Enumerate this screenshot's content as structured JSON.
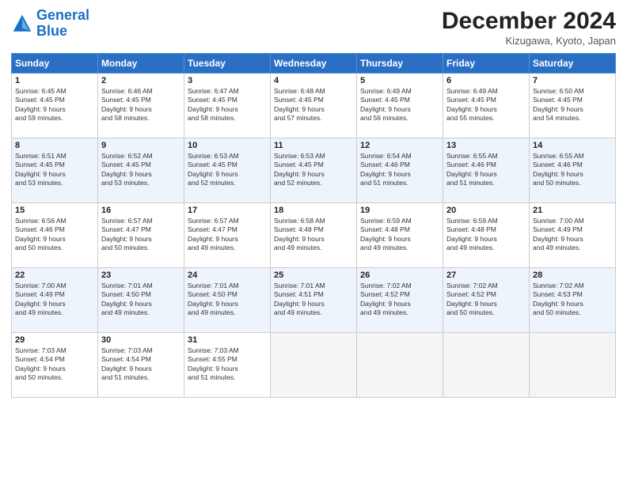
{
  "header": {
    "logo_general": "General",
    "logo_blue": "Blue",
    "title": "December 2024",
    "location": "Kizugawa, Kyoto, Japan"
  },
  "columns": [
    "Sunday",
    "Monday",
    "Tuesday",
    "Wednesday",
    "Thursday",
    "Friday",
    "Saturday"
  ],
  "weeks": [
    [
      {
        "day": "1",
        "info": "Sunrise: 6:45 AM\nSunset: 4:45 PM\nDaylight: 9 hours\nand 59 minutes."
      },
      {
        "day": "2",
        "info": "Sunrise: 6:46 AM\nSunset: 4:45 PM\nDaylight: 9 hours\nand 58 minutes."
      },
      {
        "day": "3",
        "info": "Sunrise: 6:47 AM\nSunset: 4:45 PM\nDaylight: 9 hours\nand 58 minutes."
      },
      {
        "day": "4",
        "info": "Sunrise: 6:48 AM\nSunset: 4:45 PM\nDaylight: 9 hours\nand 57 minutes."
      },
      {
        "day": "5",
        "info": "Sunrise: 6:49 AM\nSunset: 4:45 PM\nDaylight: 9 hours\nand 56 minutes."
      },
      {
        "day": "6",
        "info": "Sunrise: 6:49 AM\nSunset: 4:45 PM\nDaylight: 9 hours\nand 55 minutes."
      },
      {
        "day": "7",
        "info": "Sunrise: 6:50 AM\nSunset: 4:45 PM\nDaylight: 9 hours\nand 54 minutes."
      }
    ],
    [
      {
        "day": "8",
        "info": "Sunrise: 6:51 AM\nSunset: 4:45 PM\nDaylight: 9 hours\nand 53 minutes."
      },
      {
        "day": "9",
        "info": "Sunrise: 6:52 AM\nSunset: 4:45 PM\nDaylight: 9 hours\nand 53 minutes."
      },
      {
        "day": "10",
        "info": "Sunrise: 6:53 AM\nSunset: 4:45 PM\nDaylight: 9 hours\nand 52 minutes."
      },
      {
        "day": "11",
        "info": "Sunrise: 6:53 AM\nSunset: 4:45 PM\nDaylight: 9 hours\nand 52 minutes."
      },
      {
        "day": "12",
        "info": "Sunrise: 6:54 AM\nSunset: 4:46 PM\nDaylight: 9 hours\nand 51 minutes."
      },
      {
        "day": "13",
        "info": "Sunrise: 6:55 AM\nSunset: 4:46 PM\nDaylight: 9 hours\nand 51 minutes."
      },
      {
        "day": "14",
        "info": "Sunrise: 6:55 AM\nSunset: 4:46 PM\nDaylight: 9 hours\nand 50 minutes."
      }
    ],
    [
      {
        "day": "15",
        "info": "Sunrise: 6:56 AM\nSunset: 4:46 PM\nDaylight: 9 hours\nand 50 minutes."
      },
      {
        "day": "16",
        "info": "Sunrise: 6:57 AM\nSunset: 4:47 PM\nDaylight: 9 hours\nand 50 minutes."
      },
      {
        "day": "17",
        "info": "Sunrise: 6:57 AM\nSunset: 4:47 PM\nDaylight: 9 hours\nand 49 minutes."
      },
      {
        "day": "18",
        "info": "Sunrise: 6:58 AM\nSunset: 4:48 PM\nDaylight: 9 hours\nand 49 minutes."
      },
      {
        "day": "19",
        "info": "Sunrise: 6:59 AM\nSunset: 4:48 PM\nDaylight: 9 hours\nand 49 minutes."
      },
      {
        "day": "20",
        "info": "Sunrise: 6:59 AM\nSunset: 4:48 PM\nDaylight: 9 hours\nand 49 minutes."
      },
      {
        "day": "21",
        "info": "Sunrise: 7:00 AM\nSunset: 4:49 PM\nDaylight: 9 hours\nand 49 minutes."
      }
    ],
    [
      {
        "day": "22",
        "info": "Sunrise: 7:00 AM\nSunset: 4:49 PM\nDaylight: 9 hours\nand 49 minutes."
      },
      {
        "day": "23",
        "info": "Sunrise: 7:01 AM\nSunset: 4:50 PM\nDaylight: 9 hours\nand 49 minutes."
      },
      {
        "day": "24",
        "info": "Sunrise: 7:01 AM\nSunset: 4:50 PM\nDaylight: 9 hours\nand 49 minutes."
      },
      {
        "day": "25",
        "info": "Sunrise: 7:01 AM\nSunset: 4:51 PM\nDaylight: 9 hours\nand 49 minutes."
      },
      {
        "day": "26",
        "info": "Sunrise: 7:02 AM\nSunset: 4:52 PM\nDaylight: 9 hours\nand 49 minutes."
      },
      {
        "day": "27",
        "info": "Sunrise: 7:02 AM\nSunset: 4:52 PM\nDaylight: 9 hours\nand 50 minutes."
      },
      {
        "day": "28",
        "info": "Sunrise: 7:02 AM\nSunset: 4:53 PM\nDaylight: 9 hours\nand 50 minutes."
      }
    ],
    [
      {
        "day": "29",
        "info": "Sunrise: 7:03 AM\nSunset: 4:54 PM\nDaylight: 9 hours\nand 50 minutes."
      },
      {
        "day": "30",
        "info": "Sunrise: 7:03 AM\nSunset: 4:54 PM\nDaylight: 9 hours\nand 51 minutes."
      },
      {
        "day": "31",
        "info": "Sunrise: 7:03 AM\nSunset: 4:55 PM\nDaylight: 9 hours\nand 51 minutes."
      },
      null,
      null,
      null,
      null
    ]
  ]
}
